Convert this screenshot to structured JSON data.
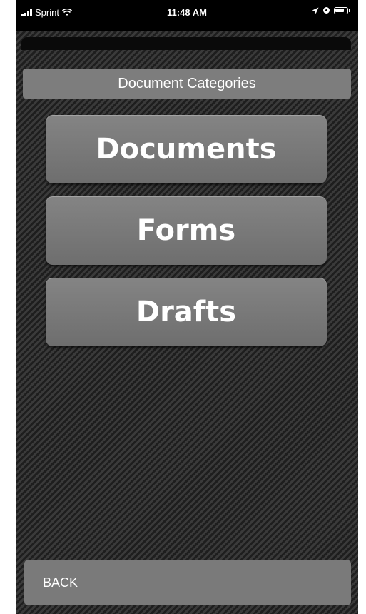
{
  "status_bar": {
    "carrier": "Sprint",
    "time": "11:48 AM",
    "icons": [
      "signal-icon",
      "wifi-icon",
      "location-icon",
      "alarm-icon",
      "battery-icon"
    ]
  },
  "header": {
    "title": "Document Categories"
  },
  "categories": [
    {
      "label": "Documents"
    },
    {
      "label": "Forms"
    },
    {
      "label": "Drafts"
    }
  ],
  "footer": {
    "back_label": "BACK"
  },
  "colors": {
    "button_gray": "#7d7d7d",
    "background_dark": "#262626",
    "text": "#ffffff"
  }
}
